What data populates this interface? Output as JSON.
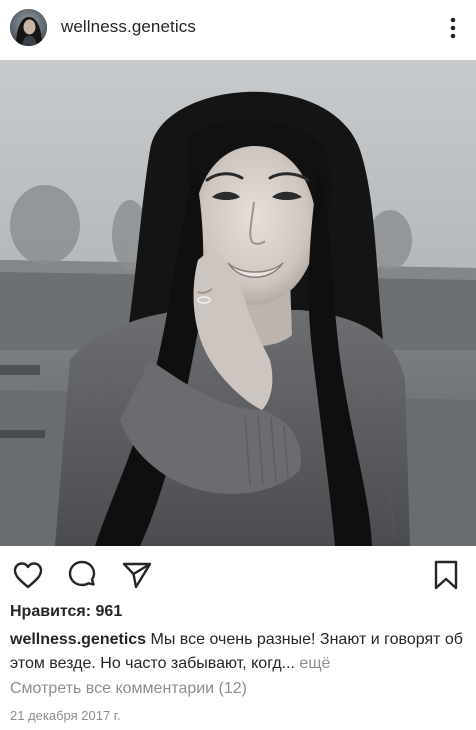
{
  "header": {
    "username": "wellness.genetics",
    "avatar_icon": "profile-avatar",
    "more_icon": "more-vertical-icon"
  },
  "post": {
    "image_icon": "post-photo"
  },
  "actions": {
    "like_icon": "heart-icon",
    "comment_icon": "comment-icon",
    "share_icon": "send-icon",
    "save_icon": "bookmark-icon"
  },
  "likes": {
    "text": "Нравится: 961"
  },
  "caption": {
    "username": "wellness.genetics",
    "text": " Мы все очень разные! Знают и говорят об этом везде. Но часто забывают, когд...",
    "more": " ещё"
  },
  "comments": {
    "text": "Смотреть все комментарии (12)"
  },
  "date": {
    "text": "21 декабря 2017 г."
  },
  "colors": {
    "text": "#262626",
    "muted": "#8e8e8e",
    "background": "#ffffff"
  }
}
